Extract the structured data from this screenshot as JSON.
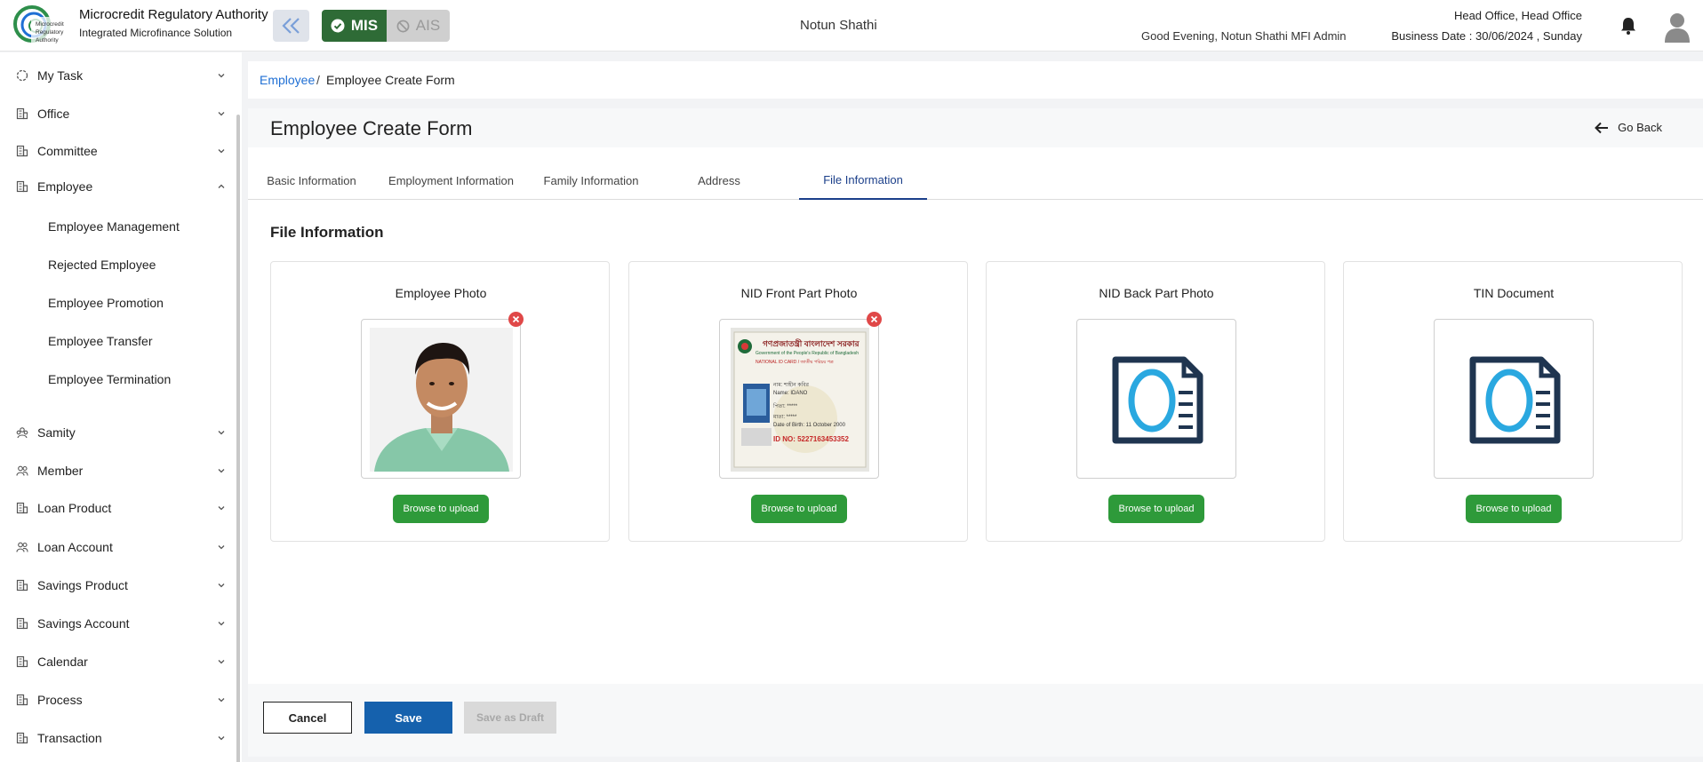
{
  "header": {
    "org_name": "Microcredit Regulatory Authority",
    "org_sub": "Integrated Microfinance Solution",
    "logo_text": "Microcredit Regulatory Authority",
    "mis_label": "MIS",
    "ais_label": "AIS",
    "center_title": "Notun Shathi",
    "greeting": "Good Evening, Notun Shathi MFI Admin",
    "office": "Head Office, Head Office",
    "business_date": "Business Date : 30/06/2024 , Sunday"
  },
  "sidebar": {
    "items": [
      {
        "label": "My Task",
        "icon": "task-icon"
      },
      {
        "label": "Office",
        "icon": "building-icon"
      },
      {
        "label": "Committee",
        "icon": "building-icon"
      },
      {
        "label": "Employee",
        "icon": "building-icon"
      },
      {
        "label": "Samity",
        "icon": "group-icon"
      },
      {
        "label": "Member",
        "icon": "people-icon"
      },
      {
        "label": "Loan Product",
        "icon": "building-icon"
      },
      {
        "label": "Loan Account",
        "icon": "people-icon"
      },
      {
        "label": "Savings Product",
        "icon": "building-icon"
      },
      {
        "label": "Savings Account",
        "icon": "building-icon"
      },
      {
        "label": "Calendar",
        "icon": "building-icon"
      },
      {
        "label": "Process",
        "icon": "building-icon"
      },
      {
        "label": "Transaction",
        "icon": "building-icon"
      }
    ],
    "employee_sub": [
      "Employee Management",
      "Rejected Employee",
      "Employee Promotion",
      "Employee Transfer",
      "Employee Termination"
    ]
  },
  "breadcrumb": {
    "link": "Employee",
    "separator": "/",
    "current": "Employee Create Form"
  },
  "form": {
    "title": "Employee Create Form",
    "go_back": "Go Back",
    "tabs": [
      "Basic Information",
      "Employment Information",
      "Family Information",
      "Address",
      "File Information"
    ],
    "active_tab": "File Information",
    "section_title": "File Information",
    "cards": [
      {
        "title": "Employee Photo",
        "upload": "Browse to upload",
        "has_file": true
      },
      {
        "title": "NID Front Part Photo",
        "upload": "Browse to upload",
        "has_file": true
      },
      {
        "title": "NID Back Part Photo",
        "upload": "Browse to upload",
        "has_file": false
      },
      {
        "title": "TIN Document",
        "upload": "Browse to upload",
        "has_file": false
      }
    ],
    "nid_card": {
      "header_bn": "গণপ্রজাতন্ত্রী বাংলাদেশ সরকার",
      "header_en": "Government of the People's Republic of Bangladesh",
      "card_label": "NATIONAL ID CARD / জাতীয় পরিচয় পত্র",
      "name_bn": "নাম: শাহীন কবির",
      "name_en": "Name: IDANO",
      "father": "পিতা: *****",
      "mother": "মাতা: *****",
      "dob": "Date of Birth: 11 October 2000",
      "id_no": "ID NO: 5227163453352"
    },
    "buttons": {
      "cancel": "Cancel",
      "save": "Save",
      "save_draft": "Save as Draft"
    }
  },
  "colors": {
    "mis_green": "#2e6b36",
    "upload_green": "#2e9a3a",
    "save_blue": "#1561ad",
    "link_blue": "#1f6fd4",
    "active_tab": "#1b3f8a",
    "remove_red": "#e04848"
  }
}
